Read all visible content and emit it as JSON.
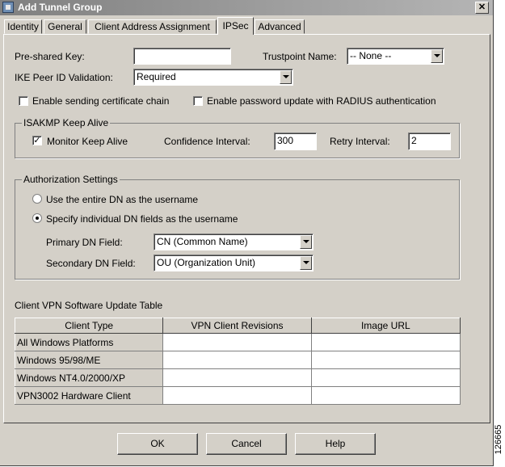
{
  "window": {
    "title": "Add Tunnel Group",
    "close_glyph": "✕"
  },
  "tabs": [
    {
      "label": "Identity"
    },
    {
      "label": "General"
    },
    {
      "label": "Client Address Assignment"
    },
    {
      "label": "IPSec",
      "active": true
    },
    {
      "label": "Advanced"
    }
  ],
  "ipsec": {
    "preshared_key": {
      "label": "Pre-shared Key:",
      "value": ""
    },
    "trustpoint": {
      "label": "Trustpoint Name:",
      "value": "-- None --"
    },
    "ike_peer": {
      "label": "IKE Peer ID Validation:",
      "value": "Required"
    },
    "send_cert_chain": {
      "label": "Enable sending certificate chain",
      "checked": false
    },
    "pw_update": {
      "label": "Enable password update with RADIUS authentication",
      "checked": false
    },
    "keepalive": {
      "legend": "ISAKMP Keep Alive",
      "monitor": {
        "label": "Monitor Keep Alive",
        "checked": true,
        "glyph": "✓"
      },
      "confidence": {
        "label": "Confidence Interval:",
        "value": "300"
      },
      "retry": {
        "label": "Retry Interval:",
        "value": "2"
      }
    },
    "authorization": {
      "legend": "Authorization Settings",
      "radio_entire": {
        "label": "Use the entire DN as the username",
        "selected": false
      },
      "radio_individual": {
        "label": "Specify individual DN fields as the username",
        "selected": true
      },
      "primary": {
        "label": "Primary DN Field:",
        "value": "CN (Common Name)"
      },
      "secondary": {
        "label": "Secondary DN Field:",
        "value": "OU (Organization Unit)"
      }
    },
    "vpn_table": {
      "title": "Client VPN Software Update Table",
      "columns": [
        "Client Type",
        "VPN Client Revisions",
        "Image URL"
      ],
      "rows": [
        {
          "client_type": "All Windows Platforms",
          "revisions": "",
          "url": ""
        },
        {
          "client_type": "Windows 95/98/ME",
          "revisions": "",
          "url": ""
        },
        {
          "client_type": "Windows NT4.0/2000/XP",
          "revisions": "",
          "url": ""
        },
        {
          "client_type": "VPN3002 Hardware Client",
          "revisions": "",
          "url": ""
        }
      ]
    }
  },
  "buttons": {
    "ok": "OK",
    "cancel": "Cancel",
    "help": "Help"
  },
  "figure_id": "126665"
}
